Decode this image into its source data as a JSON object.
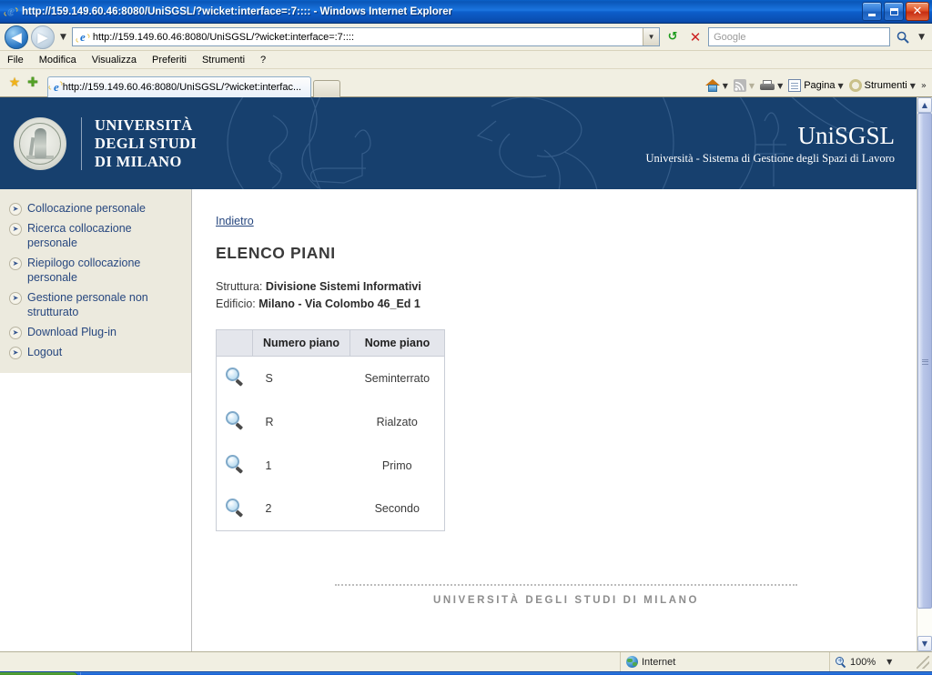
{
  "window": {
    "title": "http://159.149.60.46:8080/UniSGSL/?wicket:interface=:7:::: - Windows Internet Explorer",
    "icon": "ie-logo-icon",
    "minimize_label": "Minimize",
    "restore_label": "Restore",
    "close_label": "✕"
  },
  "addressbar": {
    "back_icon": "◀",
    "forward_icon": "▶",
    "history_caret": "▼",
    "url": "http://159.149.60.46:8080/UniSGSL/?wicket:interface=:7::::",
    "url_dropdown_caret": "▼",
    "refresh_icon": "↺",
    "stop_icon": "✕",
    "search_placeholder": "Google",
    "search_value": "",
    "search_go_icon": "search-icon",
    "search_caret": "▼"
  },
  "menubar": {
    "items": [
      {
        "label": "File",
        "accel": "F"
      },
      {
        "label": "Modifica",
        "accel": "M"
      },
      {
        "label": "Visualizza",
        "accel": "V"
      },
      {
        "label": "Preferiti",
        "accel": "P"
      },
      {
        "label": "Strumenti",
        "accel": "S"
      },
      {
        "label": "?",
        "accel": "?"
      }
    ]
  },
  "commandbar": {
    "favorites_star_icon": "★",
    "add_favorite_icon": "✚",
    "tab_label": "http://159.149.60.46:8080/UniSGSL/?wicket:interfac...",
    "new_tab_label": "",
    "home_label": "",
    "feeds_label": "",
    "print_label": "",
    "page_label": "Pagina",
    "tools_label": "Strumenti",
    "overflow_icon": "»",
    "caret": "▼"
  },
  "banner": {
    "seal_alt": "university-seal",
    "university_lines": [
      "UNIVERSITÀ",
      "DEGLI STUDI",
      "DI MILANO"
    ],
    "brand": "UniSGSL",
    "subtitle": "Università - Sistema di Gestione degli Spazi di Lavoro",
    "bg_color": "#17406e"
  },
  "sidebar": {
    "items": [
      {
        "label": "Collocazione personale",
        "icon": "arrow-circle-icon"
      },
      {
        "label": "Ricerca collocazione personale",
        "icon": "arrow-circle-icon"
      },
      {
        "label": "Riepilogo collocazione personale",
        "icon": "arrow-circle-icon"
      },
      {
        "label": "Gestione personale non strutturato",
        "icon": "arrow-circle-icon"
      },
      {
        "label": "Download Plug-in",
        "icon": "arrow-circle-icon"
      },
      {
        "label": "Logout",
        "icon": "arrow-circle-icon"
      }
    ],
    "link_color": "#27477f",
    "panel_color": "#eceade"
  },
  "main": {
    "back_link": "Indietro",
    "page_title": "ELENCO PIANI",
    "meta": [
      {
        "label": "Struttura:",
        "value": "Divisione Sistemi Informativi"
      },
      {
        "label": "Edificio:",
        "value": "Milano - Via Colombo 46_Ed 1"
      }
    ],
    "table": {
      "columns": [
        "",
        "Numero piano",
        "Nome piano"
      ],
      "rows": [
        {
          "icon": "magnifier-icon",
          "numero": "S",
          "nome": "Seminterrato"
        },
        {
          "icon": "magnifier-icon",
          "numero": "R",
          "nome": "Rialzato"
        },
        {
          "icon": "magnifier-icon",
          "numero": "1",
          "nome": "Primo"
        },
        {
          "icon": "magnifier-icon",
          "numero": "2",
          "nome": "Secondo"
        }
      ]
    }
  },
  "footer": {
    "text": "UNIVERSITÀ DEGLI STUDI DI MILANO"
  },
  "scrollbar": {
    "up_icon": "▲",
    "down_icon": "▼"
  },
  "statusbar": {
    "message": "",
    "zone_icon": "globe-icon",
    "zone": "Internet",
    "zoom_icon": "zoom-icon",
    "zoom_level": "100%",
    "zoom_caret": "▼"
  }
}
